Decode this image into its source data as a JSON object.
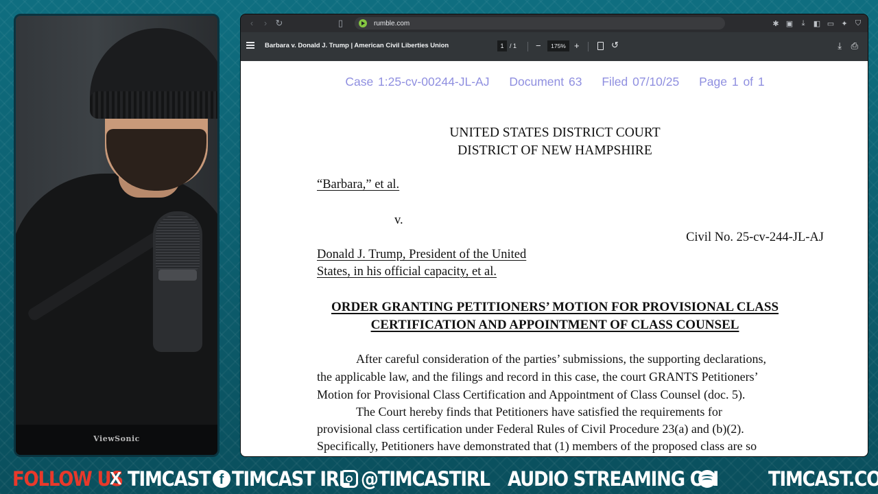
{
  "webcam": {
    "monitor_brand": "ViewSonic"
  },
  "browser": {
    "url": "rumble.com",
    "nav_back_icon": "chevron-left-icon",
    "nav_forward_icon": "chevron-right-icon",
    "reload_icon": "reload-icon"
  },
  "pdf_toolbar": {
    "title": "Barbara v. Donald J. Trump | American Civil Liberties Union",
    "current_page": "1",
    "page_total": "/  1",
    "zoom": "175%"
  },
  "document": {
    "stamp": {
      "case": "Case 1:25-cv-00244-JL-AJ",
      "document": "Document 63",
      "filed": "Filed 07/10/25",
      "page": "Page 1 of 1"
    },
    "court_line1": "UNITED STATES DISTRICT COURT",
    "court_line2": "DISTRICT OF NEW HAMPSHIRE",
    "plaintiff": "“Barbara,” et al.",
    "versus": "v.",
    "civil_no": "Civil No. 25-cv-244-JL-AJ",
    "defendant_line1": "Donald J. Trump, President of the United",
    "defendant_line2": "States, in his official capacity, et al.",
    "heading_line1": "ORDER GRANTING PETITIONERS’ MOTION FOR PROVISIONAL CLASS",
    "heading_line2": "CERTIFICATION AND APPOINTMENT OF CLASS COUNSEL",
    "body_lines": [
      "After careful consideration of the parties’ submissions, the supporting declarations,",
      "the applicable law, and the filings and record in this case, the court GRANTS Petitioners’",
      "Motion for Provisional Class Certification and Appointment of Class Counsel (doc. 5).",
      "The Court hereby finds that Petitioners have satisfied the requirements for",
      "provisional class certification under Federal Rules of Civil Procedure 23(a) and (b)(2).",
      "Specifically, Petitioners have demonstrated that (1) members of the proposed class are so"
    ]
  },
  "banner": {
    "follow": "FOLLOW US",
    "x_handle": "TIMCAST",
    "fb_handle": "TIMCAST IRL",
    "ig_handle": "@TIMCASTIRL",
    "audio": "AUDIO STREAMING ON",
    "site": "TIMCAST.COM"
  },
  "colors": {
    "background": "#0c5a6a",
    "follow_red": "#e8392b",
    "stamp_blue": "#8f8fe0"
  }
}
